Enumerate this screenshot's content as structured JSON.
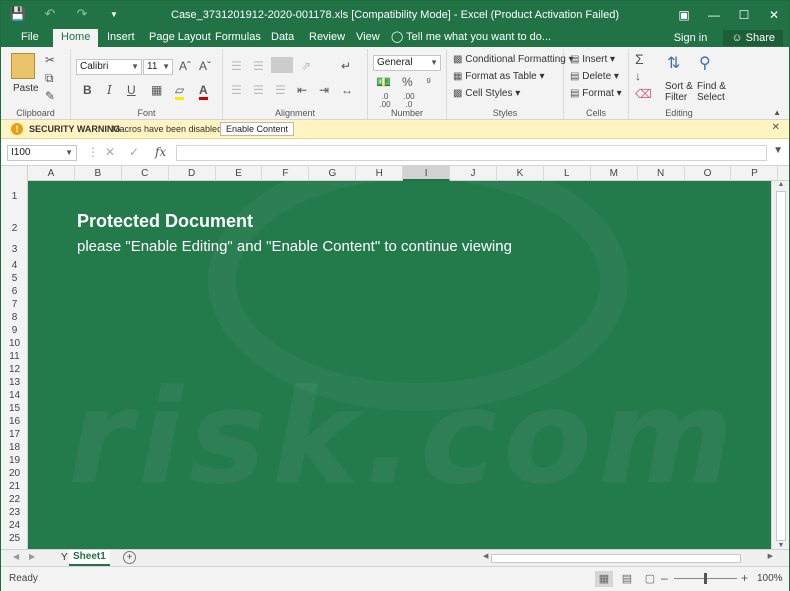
{
  "window": {
    "title": "Case_3731201912-2020-001178.xls  [Compatibility Mode] - Excel (Product Activation Failed)"
  },
  "qat": {
    "save_icon": "save-icon",
    "undo_icon": "undo-icon",
    "redo_icon": "redo-icon",
    "customize_icon": "chevron-down-icon"
  },
  "tabs": [
    "File",
    "Home",
    "Insert",
    "Page Layout",
    "Formulas",
    "Data",
    "Review",
    "View"
  ],
  "active_tab": "Home",
  "tell_me": "Tell me what you want to do...",
  "sign_in": "Sign in",
  "share": "Share",
  "ribbon": {
    "clipboard": {
      "label": "Clipboard",
      "paste": "Paste"
    },
    "font": {
      "label": "Font",
      "font_name": "Calibri",
      "font_size": "11",
      "bold": "B",
      "italic": "I",
      "underline": "U"
    },
    "alignment": {
      "label": "Alignment"
    },
    "number": {
      "label": "Number",
      "format": "General",
      "percent": "%",
      "comma": "⁹",
      "inc_decimal": ".0 .00",
      "dec_decimal": ".00 .0"
    },
    "styles": {
      "label": "Styles",
      "conditional": "Conditional Formatting",
      "format_table": "Format as Table",
      "cell_styles": "Cell Styles"
    },
    "cells": {
      "label": "Cells",
      "insert": "Insert",
      "delete": "Delete",
      "format": "Format"
    },
    "editing": {
      "label": "Editing",
      "sort": "Sort &",
      "filter": "Filter",
      "find": "Find &",
      "select": "Select"
    }
  },
  "security": {
    "title": "SECURITY WARNING",
    "message": "Macros have been disabled.",
    "button": "Enable Content"
  },
  "formula_bar": {
    "name_box": "I100",
    "fx": "fx",
    "value": ""
  },
  "columns": [
    "A",
    "B",
    "C",
    "D",
    "E",
    "F",
    "G",
    "H",
    "I",
    "J",
    "K",
    "L",
    "M",
    "N",
    "O",
    "P"
  ],
  "selected_column": "I",
  "rows": [
    "1",
    "2",
    "3",
    "4",
    "5",
    "6",
    "7",
    "8",
    "9",
    "10",
    "11",
    "12",
    "13",
    "14",
    "15",
    "16",
    "17",
    "18",
    "19",
    "20",
    "21",
    "22",
    "23",
    "24",
    "25"
  ],
  "content": {
    "title": "Protected Document",
    "message": "please \"Enable Editing\" and \"Enable Content\" to continue viewing",
    "watermark": "risk.com"
  },
  "sheets": {
    "prev": "Y",
    "active": "Sheet1"
  },
  "status": {
    "ready": "Ready",
    "zoom": "100%",
    "zoom_fraction": 0.5
  },
  "colors": {
    "accent": "#217346",
    "sheet_bg": "#237a4b",
    "warning_bg": "#fff4c2"
  }
}
